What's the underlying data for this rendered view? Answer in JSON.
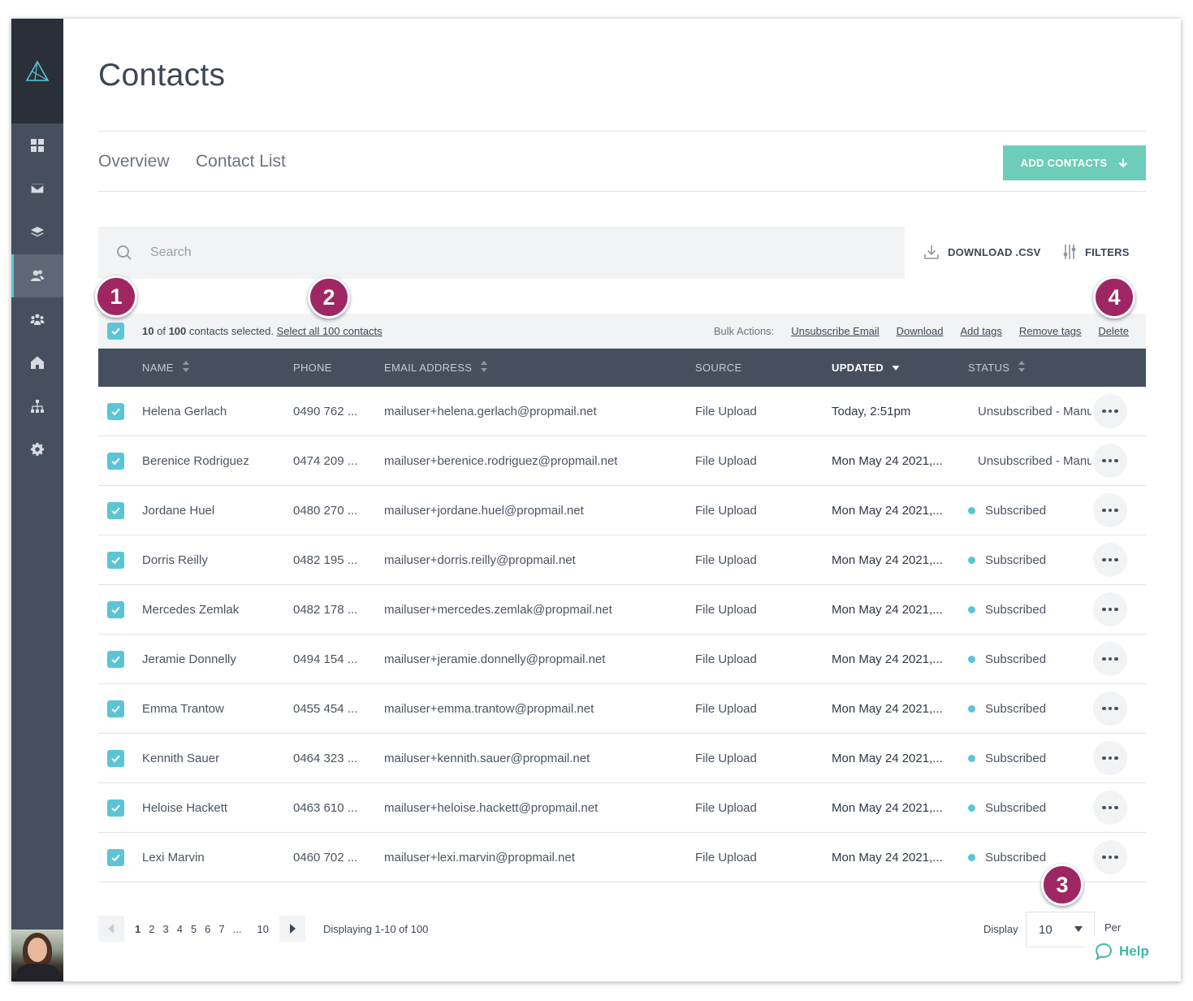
{
  "page": {
    "title": "Contacts"
  },
  "tabs": [
    {
      "label": "Overview"
    },
    {
      "label": "Contact List"
    }
  ],
  "add_contacts": {
    "label": "ADD CONTACTS"
  },
  "search": {
    "placeholder": "Search"
  },
  "toolbar": {
    "download_label": "DOWNLOAD .CSV",
    "filters_label": "FILTERS"
  },
  "selection": {
    "count": "10",
    "of_text": "of",
    "total": "100",
    "suffix": "contacts selected.",
    "select_all_label": "Select all 100 contacts"
  },
  "bulk": {
    "label": "Bulk Actions:",
    "actions": [
      "Unsubscribe Email",
      "Download",
      "Add tags",
      "Remove tags",
      "Delete"
    ]
  },
  "columns": {
    "name": "NAME",
    "phone": "PHONE",
    "email": "EMAIL ADDRESS",
    "source": "SOURCE",
    "updated": "UPDATED",
    "status": "STATUS"
  },
  "status_colors": {
    "unsubscribed": "#e5484d",
    "subscribed": "#5bc5d6"
  },
  "accent": "#6dcdb8",
  "rows": [
    {
      "name": "Helena Gerlach",
      "phone": "0490 762 ...",
      "email": "mailuser+helena.gerlach@propmail.net",
      "source": "File Upload",
      "updated": "Today, 2:51pm",
      "status": "Unsubscribed - Manual",
      "status_type": "unsubscribed"
    },
    {
      "name": "Berenice Rodriguez",
      "phone": "0474 209 ...",
      "email": "mailuser+berenice.rodriguez@propmail.net",
      "source": "File Upload",
      "updated": "Mon May 24 2021,...",
      "status": "Unsubscribed - Manual",
      "status_type": "unsubscribed"
    },
    {
      "name": "Jordane Huel",
      "phone": "0480 270 ...",
      "email": "mailuser+jordane.huel@propmail.net",
      "source": "File Upload",
      "updated": "Mon May 24 2021,...",
      "status": "Subscribed",
      "status_type": "subscribed"
    },
    {
      "name": "Dorris Reilly",
      "phone": "0482 195 ...",
      "email": "mailuser+dorris.reilly@propmail.net",
      "source": "File Upload",
      "updated": "Mon May 24 2021,...",
      "status": "Subscribed",
      "status_type": "subscribed"
    },
    {
      "name": "Mercedes Zemlak",
      "phone": "0482 178 ...",
      "email": "mailuser+mercedes.zemlak@propmail.net",
      "source": "File Upload",
      "updated": "Mon May 24 2021,...",
      "status": "Subscribed",
      "status_type": "subscribed"
    },
    {
      "name": "Jeramie Donnelly",
      "phone": "0494 154 ...",
      "email": "mailuser+jeramie.donnelly@propmail.net",
      "source": "File Upload",
      "updated": "Mon May 24 2021,...",
      "status": "Subscribed",
      "status_type": "subscribed"
    },
    {
      "name": "Emma Trantow",
      "phone": "0455 454 ...",
      "email": "mailuser+emma.trantow@propmail.net",
      "source": "File Upload",
      "updated": "Mon May 24 2021,...",
      "status": "Subscribed",
      "status_type": "subscribed"
    },
    {
      "name": "Kennith Sauer",
      "phone": "0464 323 ...",
      "email": "mailuser+kennith.sauer@propmail.net",
      "source": "File Upload",
      "updated": "Mon May 24 2021,...",
      "status": "Subscribed",
      "status_type": "subscribed"
    },
    {
      "name": "Heloise Hackett",
      "phone": "0463 610 ...",
      "email": "mailuser+heloise.hackett@propmail.net",
      "source": "File Upload",
      "updated": "Mon May 24 2021,...",
      "status": "Subscribed",
      "status_type": "subscribed"
    },
    {
      "name": "Lexi Marvin",
      "phone": "0460 702 ...",
      "email": "mailuser+lexi.marvin@propmail.net",
      "source": "File Upload",
      "updated": "Mon May 24 2021,...",
      "status": "Subscribed",
      "status_type": "subscribed"
    }
  ],
  "pagination": {
    "pages": [
      "1",
      "2",
      "3",
      "4",
      "5",
      "6",
      "7",
      "...",
      "10"
    ],
    "current": "1",
    "displaying": "Displaying 1-10 of 100"
  },
  "display": {
    "label": "Display",
    "value": "10",
    "per_page_label": "Per Page"
  },
  "help": {
    "label": "Help"
  },
  "badges": [
    "1",
    "2",
    "3",
    "4"
  ],
  "sidebar": {
    "icons": [
      "dashboard-icon",
      "mail-icon",
      "layers-icon",
      "contacts-icon",
      "group-icon",
      "home-icon",
      "sitemap-icon",
      "settings-icon"
    ],
    "active_index": 3
  }
}
